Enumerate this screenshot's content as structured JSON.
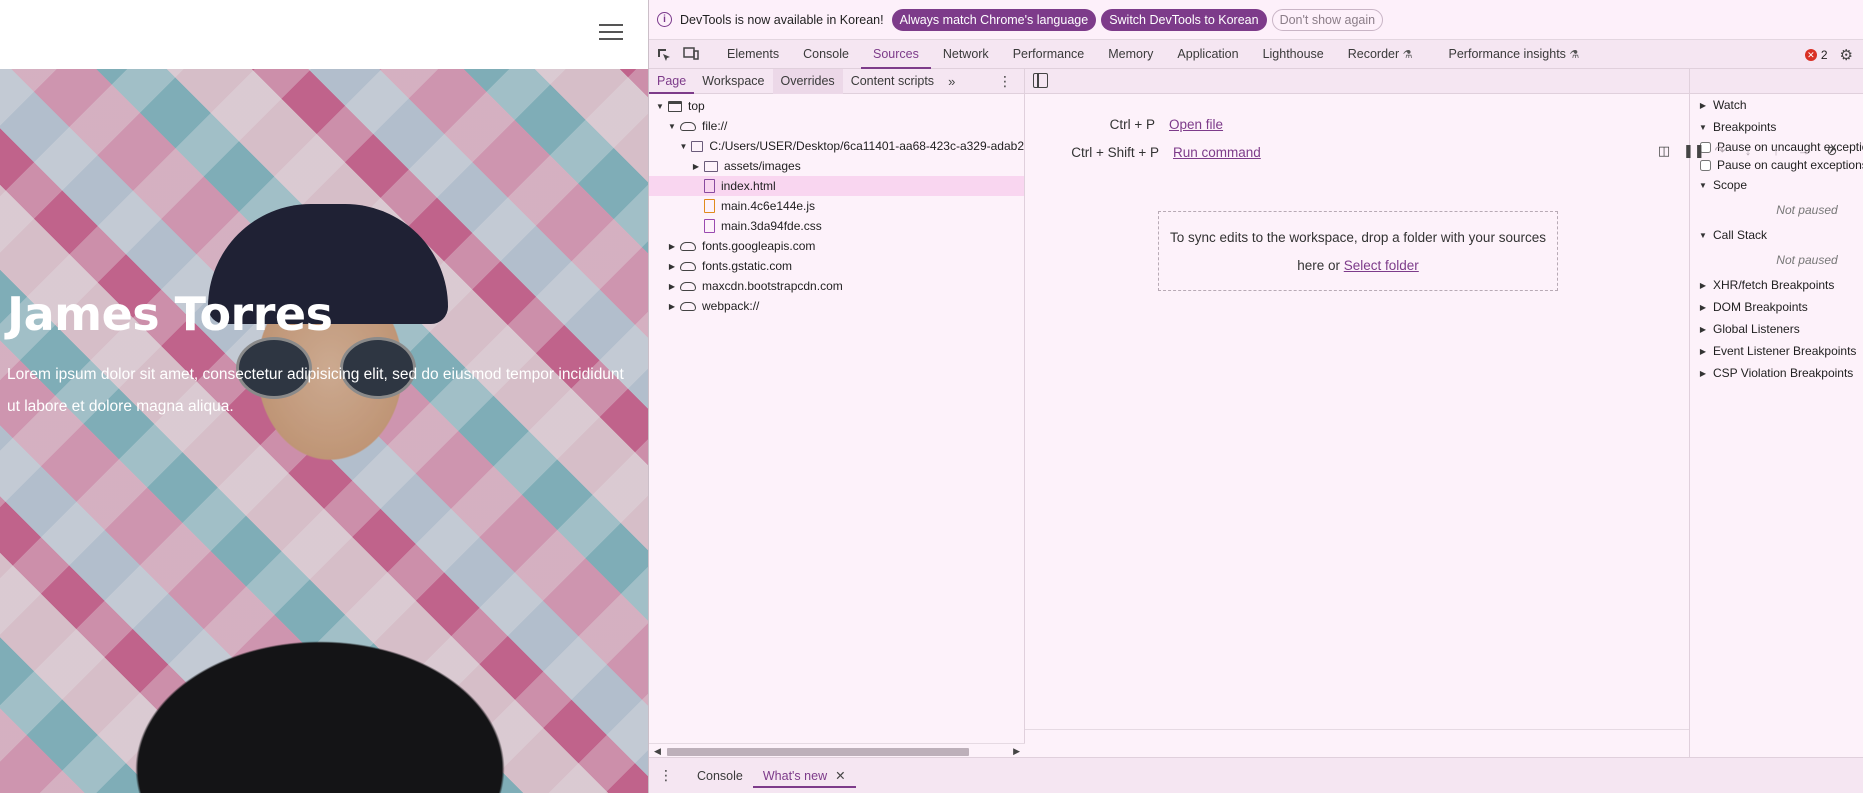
{
  "site": {
    "hero_title": "James Torres",
    "hero_description": "Lorem ipsum dolor sit amet, consectetur adipisicing elit, sed do eiusmod tempor incididunt ut labore et dolore magna aliqua."
  },
  "infobar": {
    "message": "DevTools is now available in Korean!",
    "btn_match": "Always match Chrome's language",
    "btn_switch": "Switch DevTools to Korean",
    "btn_dismiss": "Don't show again"
  },
  "main_tabs": [
    "Elements",
    "Console",
    "Sources",
    "Network",
    "Performance",
    "Memory",
    "Application",
    "Lighthouse",
    "Recorder",
    "Performance insights"
  ],
  "active_main_tab": "Sources",
  "error_count": "2",
  "nav_tabs": [
    "Page",
    "Workspace",
    "Overrides",
    "Content scripts"
  ],
  "tree": {
    "top": "top",
    "file": "file://",
    "desktop_path": "C:/Users/USER/Desktop/6ca11401-aa68-423c-a329-adab2",
    "assets": "assets/images",
    "index": "index.html",
    "js": "main.4c6e144e.js",
    "css": "main.3da94fde.css",
    "googleapis": "fonts.googleapis.com",
    "gstatic": "fonts.gstatic.com",
    "maxcdn": "maxcdn.bootstrapcdn.com",
    "webpack": "webpack://"
  },
  "editor": {
    "shortcut1_key": "Ctrl + P",
    "shortcut1_label": "Open file",
    "shortcut2_key": "Ctrl + Shift + P",
    "shortcut2_label": "Run command",
    "drop_text": "To sync edits to the workspace, drop a folder with your sources here or",
    "select_folder": "Select folder"
  },
  "debugger": {
    "watch": "Watch",
    "breakpoints": "Breakpoints",
    "pause_uncaught": "Pause on uncaught exceptions",
    "pause_caught": "Pause on caught exceptions",
    "scope": "Scope",
    "not_paused": "Not paused",
    "call_stack": "Call Stack",
    "xhr": "XHR/fetch Breakpoints",
    "dom": "DOM Breakpoints",
    "global": "Global Listeners",
    "event": "Event Listener Breakpoints",
    "csp": "CSP Violation Breakpoints"
  },
  "drawer": {
    "console": "Console",
    "whats_new": "What's new"
  },
  "colors": {
    "accent": "#7d3b8a",
    "panel_bg": "#fdf2fa",
    "selected_row": "#f9d6f0",
    "error": "#d93025"
  }
}
